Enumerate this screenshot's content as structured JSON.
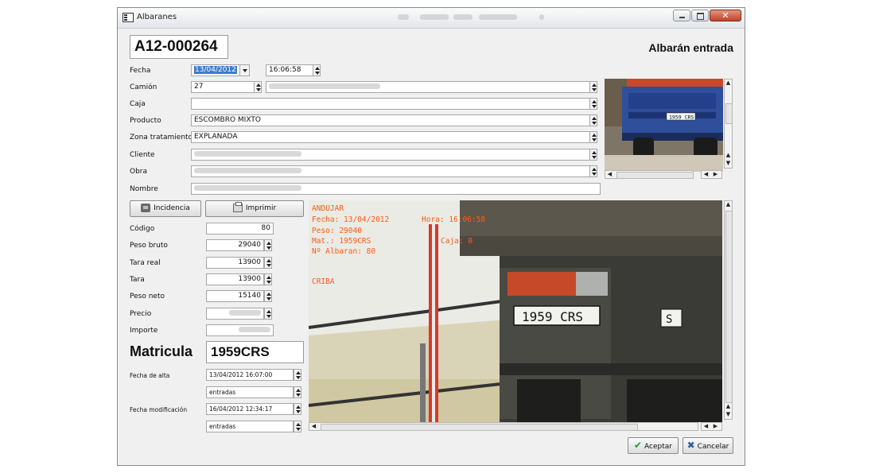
{
  "window": {
    "title": "Albaranes",
    "close_glyph": "✕"
  },
  "header": {
    "code": "A12-000264",
    "doc_type": "Albarán entrada"
  },
  "form": {
    "fecha_label": "Fecha",
    "fecha_value": "13/04/2012",
    "hora_value": "16:06:58",
    "camion_label": "Camión",
    "camion_value": "27",
    "caja_label": "Caja",
    "caja_value": "",
    "producto_label": "Producto",
    "producto_value": "ESCOMBRO MIXTO",
    "zona_label": "Zona tratamiento",
    "zona_value": "EXPLANADA",
    "cliente_label": "Cliente",
    "obra_label": "Obra",
    "nombre_label": "Nombre"
  },
  "buttons": {
    "incidencia": "Incidencia",
    "imprimir": "Imprimir",
    "aceptar": "Aceptar",
    "cancelar": "Cancelar"
  },
  "weights": {
    "codigo_label": "Código",
    "codigo_value": "80",
    "peso_bruto_label": "Peso bruto",
    "peso_bruto_value": "29040",
    "tara_real_label": "Tara real",
    "tara_real_value": "13900",
    "tara_label": "Tara",
    "tara_value": "13900",
    "peso_neto_label": "Peso neto",
    "peso_neto_value": "15140",
    "precio_label": "Precio",
    "importe_label": "Importe"
  },
  "plate": {
    "label": "Matricula",
    "value": "1959CRS"
  },
  "meta": {
    "fecha_alta_label": "Fecha de alta",
    "fecha_alta_value": "13/04/2012 16:07:00",
    "alta_origen": "entradas",
    "fecha_mod_label": "Fecha modificación",
    "fecha_mod_value": "16/04/2012 12:34:17",
    "mod_origen": "entradas"
  },
  "photo_overlay": {
    "line1": "ANDUJAR",
    "line2": "Fecha: 13/04/2012",
    "line2b": "Hora: 16:06:58",
    "line3": "Peso: 29040",
    "line4": "Mat.: 1959CRS",
    "line4b": "Caja: 0",
    "line5": "Nº Albaran: 80",
    "line6": "CRIBA",
    "plate_text": "1959 CRS",
    "small_plate_text": "1959 CRS",
    "plate_side": "S"
  },
  "colors": {
    "overlay": "#ff5a14",
    "selection": "#3a7bd5",
    "truck_blue": "#2f4f9a"
  }
}
